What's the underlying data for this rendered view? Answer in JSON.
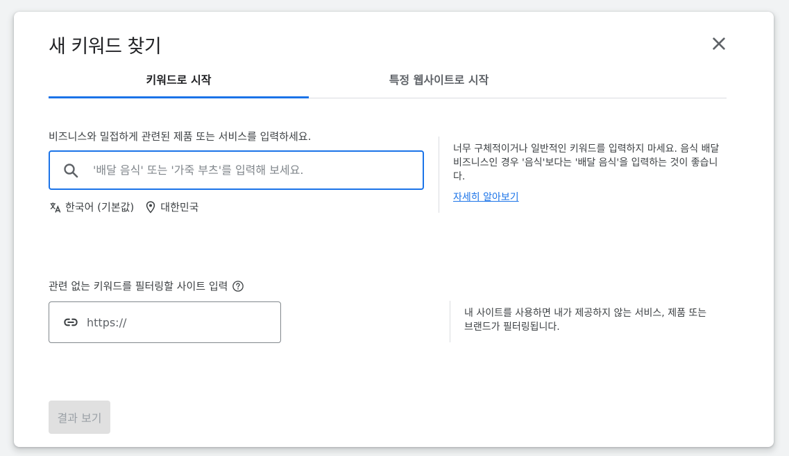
{
  "dialog": {
    "title": "새 키워드 찾기",
    "close_icon": "close-icon"
  },
  "tabs": [
    {
      "label": "키워드로 시작",
      "active": true
    },
    {
      "label": "특정 웹사이트로 시작",
      "active": false
    }
  ],
  "keywords": {
    "label": "비즈니스와 밀접하게 관련된 제품 또는 서비스를 입력하세요.",
    "placeholder": "'배달 음식' 또는 '가죽 부츠'를 입력해 보세요.",
    "value": "",
    "language": "한국어 (기본값)",
    "location": "대한민국",
    "help_text": "너무 구체적이거나 일반적인 키워드를 입력하지 마세요. 음식 배달 비즈니스인 경우 '음식'보다는 '배달 음식'을 입력하는 것이 좋습니다.",
    "learn_more": "자세히 알아보기"
  },
  "site_filter": {
    "label": "관련 없는 키워드를 필터링할 사이트 입력",
    "placeholder": "https://",
    "value": "",
    "help_text": "내 사이트를 사용하면 내가 제공하지 않는 서비스, 제품 또는 브랜드가 필터링됩니다."
  },
  "submit_label": "결과 보기",
  "colors": {
    "accent": "#1a73e8",
    "disabled_bg": "#e0e0e0",
    "disabled_text": "#9aa0a6"
  }
}
